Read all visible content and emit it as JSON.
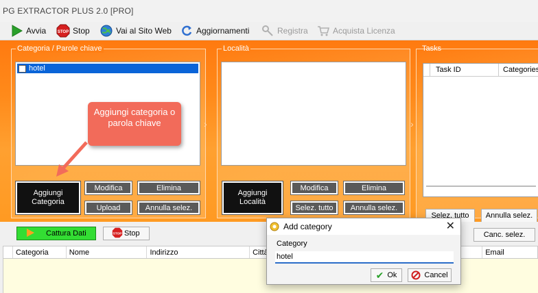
{
  "window": {
    "title": "PG EXTRACTOR PLUS 2.0 [PRO]"
  },
  "toolbar": {
    "avvia": "Avvia",
    "stop": "Stop",
    "sito": "Vai al Sito Web",
    "aggiornamenti": "Aggiornamenti",
    "registra": "Registra",
    "acquista": "Acquista Licenza"
  },
  "categoria_panel": {
    "label": "Categoria / Parole chiave",
    "items": [
      {
        "label": "hotel",
        "checked": false,
        "selected": true
      }
    ],
    "add_button": "Aggiungi Categoria",
    "modifica": "Modifica",
    "elimina": "Elimina",
    "upload": "Upload",
    "annulla": "Annulla selez."
  },
  "localita_panel": {
    "label": "Località",
    "add_button": "Aggiungi Località",
    "modifica": "Modifica",
    "elimina": "Elimina",
    "selez_tutto": "Selez. tutto",
    "annulla": "Annulla selez."
  },
  "tasks_panel": {
    "label": "Tasks",
    "columns": [
      "Task ID",
      "Categories"
    ],
    "selez_tutto": "Selez. tutto",
    "annulla": "Annulla selez."
  },
  "callout": {
    "text": "Aggiungi categoria o parola chiave"
  },
  "bottom": {
    "cattura": "Cattura Dati",
    "stop": "Stop",
    "canc_selez": "Canc. selez.",
    "columns": [
      "Categoria",
      "Nome",
      "Indirizzo",
      "Città",
      "Email"
    ]
  },
  "dialog": {
    "title": "Add category",
    "field_label": "Category",
    "field_value": "hotel",
    "ok": "Ok",
    "cancel": "Cancel"
  },
  "colors": {
    "accent_orange": "#ff8a1a",
    "callout": "#f26b5a",
    "green_button": "#33dd33",
    "grid_body": "#fffde0"
  }
}
